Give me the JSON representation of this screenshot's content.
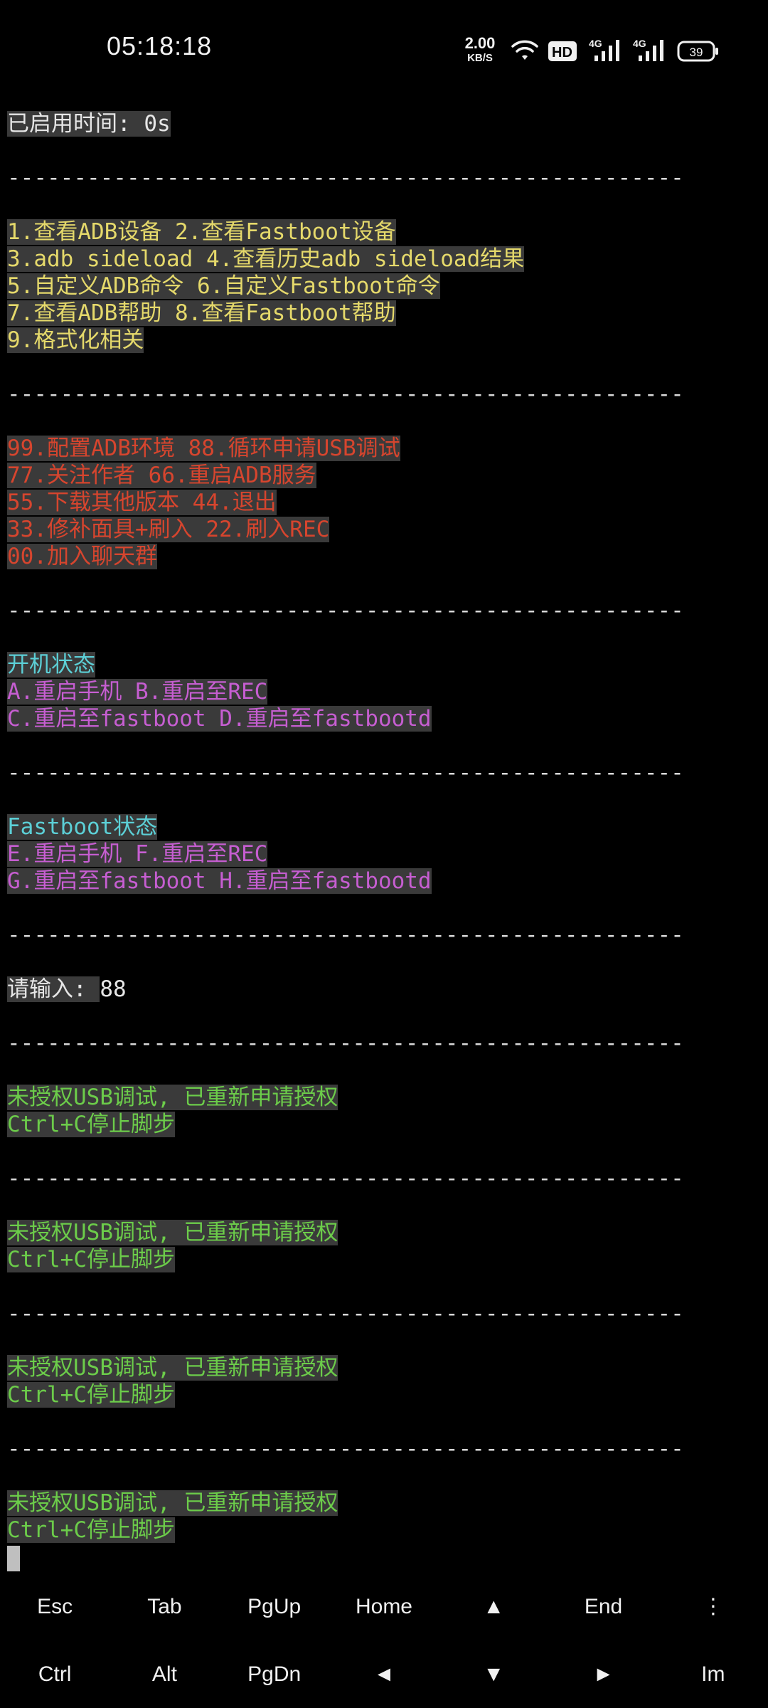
{
  "status_bar": {
    "time": "05:18:18",
    "net_speed_value": "2.00",
    "net_speed_unit": "KB/S",
    "hd_label": "HD",
    "signal1_label": "4G",
    "signal2_label": "4G",
    "battery_level": "39"
  },
  "terminal": {
    "uptime": "已启用时间: 0s",
    "separator": "---------------------------------------------------",
    "menu_main": [
      "1.查看ADB设备 2.查看Fastboot设备",
      "3.adb sideload 4.查看历史adb sideload结果",
      "5.自定义ADB命令 6.自定义Fastboot命令",
      "7.查看ADB帮助 8.查看Fastboot帮助",
      "9.格式化相关"
    ],
    "menu_extra": [
      "99.配置ADB环境 88.循环申请USB调试",
      "77.关注作者 66.重启ADB服务",
      "55.下载其他版本 44.退出",
      "33.修补面具+刷入 22.刷入REC",
      "00.加入聊天群"
    ],
    "boot_state_title": "开机状态",
    "boot_state_items": [
      "A.重启手机 B.重启至REC",
      "C.重启至fastboot D.重启至fastbootd"
    ],
    "fastboot_state_title": "Fastboot状态",
    "fastboot_state_items": [
      "E.重启手机 F.重启至REC",
      "G.重启至fastboot H.重启至fastbootd"
    ],
    "prompt": "请输入: ",
    "input_value": "88",
    "auth_message": "未授权USB调试, 已重新申请授权",
    "stop_hint": "Ctrl+C停止脚步"
  },
  "extra_keys": {
    "row1": [
      "Esc",
      "Tab",
      "PgUp",
      "Home",
      "▲",
      "End",
      "⋮"
    ],
    "row2": [
      "Ctrl",
      "Alt",
      "PgDn",
      "◄",
      "▼",
      "►",
      "Im"
    ]
  }
}
